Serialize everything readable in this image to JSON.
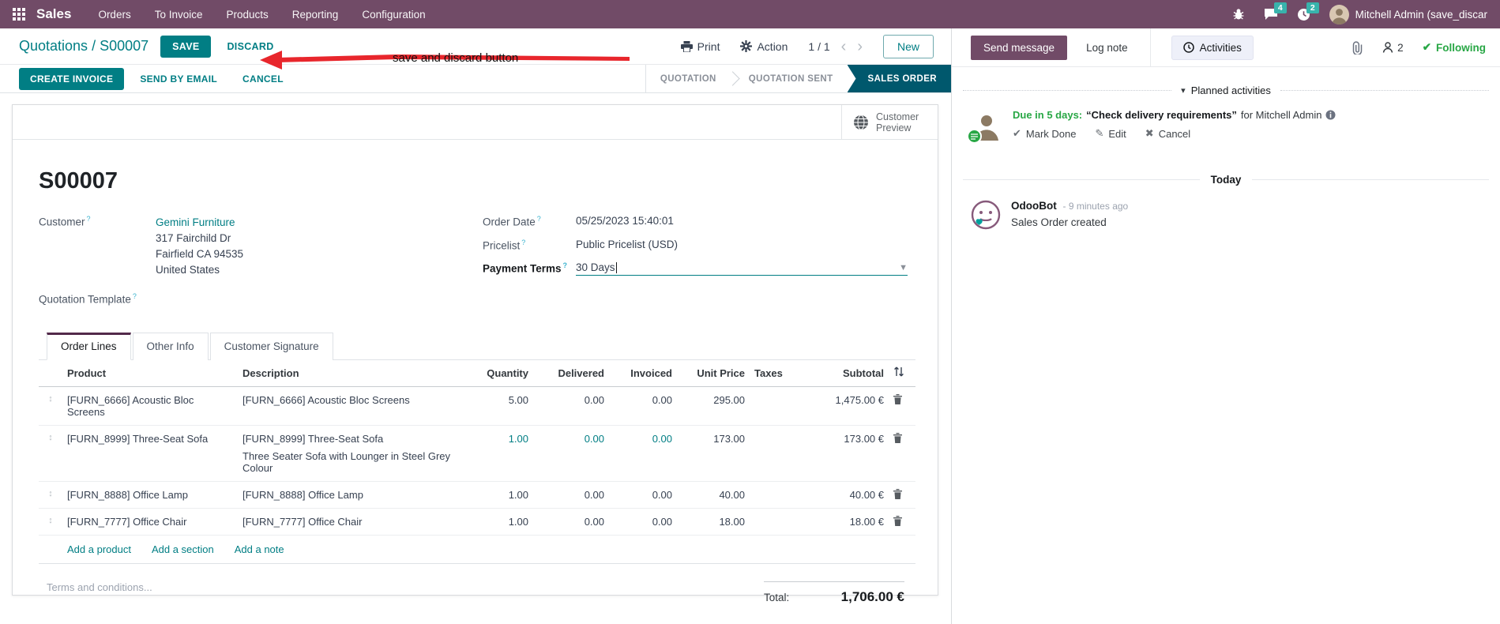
{
  "nav": {
    "app_name": "Sales",
    "menus": [
      "Orders",
      "To Invoice",
      "Products",
      "Reporting",
      "Configuration"
    ],
    "messages_count": "4",
    "activities_count": "2",
    "user_name": "Mitchell Admin (save_discar",
    "accent_color": "#714B67",
    "badge_color": "#38B3AC"
  },
  "control_panel": {
    "breadcrumb_parent": "Quotations",
    "breadcrumb_separator": "/",
    "breadcrumb_current": "S00007",
    "save_label": "SAVE",
    "discard_label": "DISCARD",
    "print_label": "Print",
    "action_label": "Action",
    "pager": "1 / 1",
    "prev": "‹",
    "next": "›",
    "new_label": "New"
  },
  "annotation": {
    "text": "save and discard button",
    "arrow_color": "#e8262c"
  },
  "statusbar": {
    "buttons": [
      {
        "label": "CREATE INVOICE",
        "style": "primary"
      },
      {
        "label": "SEND BY EMAIL",
        "style": "flat"
      },
      {
        "label": "CANCEL",
        "style": "flat"
      }
    ],
    "stages": [
      {
        "label": "QUOTATION",
        "active": false
      },
      {
        "label": "QUOTATION SENT",
        "active": false
      },
      {
        "label": "SALES ORDER",
        "active": true
      }
    ],
    "active_stage_color": "#00586d"
  },
  "form": {
    "preview_label": "Customer Preview",
    "title": "S00007",
    "customer_label": "Customer",
    "customer_name": "Gemini Furniture",
    "address_line1": "317 Fairchild Dr",
    "address_line2": "Fairfield CA 94535",
    "address_line3": "United States",
    "quotation_template_label": "Quotation Template",
    "order_date_label": "Order Date",
    "order_date_value": "05/25/2023 15:40:01",
    "pricelist_label": "Pricelist",
    "pricelist_value": "Public Pricelist (USD)",
    "payment_terms_label": "Payment Terms",
    "payment_terms_value": "30 Days"
  },
  "tabs": [
    {
      "label": "Order Lines",
      "active": true
    },
    {
      "label": "Other Info",
      "active": false
    },
    {
      "label": "Customer Signature",
      "active": false
    }
  ],
  "order_lines": {
    "columns": [
      "Product",
      "Description",
      "Quantity",
      "Delivered",
      "Invoiced",
      "Unit Price",
      "Taxes",
      "Subtotal"
    ],
    "rows": [
      {
        "product": "[FURN_6666] Acoustic Bloc Screens",
        "description": "[FURN_6666] Acoustic Bloc Screens",
        "description2": "",
        "quantity": "5.00",
        "delivered": "0.00",
        "invoiced": "0.00",
        "unit_price": "295.00",
        "taxes": "",
        "subtotal": "1,475.00 €",
        "edited": false
      },
      {
        "product": "[FURN_8999] Three-Seat Sofa",
        "description": "[FURN_8999] Three-Seat Sofa",
        "description2": "Three Seater Sofa with Lounger in Steel Grey Colour",
        "quantity": "1.00",
        "delivered": "0.00",
        "invoiced": "0.00",
        "unit_price": "173.00",
        "taxes": "",
        "subtotal": "173.00 €",
        "edited": true
      },
      {
        "product": "[FURN_8888] Office Lamp",
        "description": "[FURN_8888] Office Lamp",
        "description2": "",
        "quantity": "1.00",
        "delivered": "0.00",
        "invoiced": "0.00",
        "unit_price": "40.00",
        "taxes": "",
        "subtotal": "40.00 €",
        "edited": false
      },
      {
        "product": "[FURN_7777] Office Chair",
        "description": "[FURN_7777] Office Chair",
        "description2": "",
        "quantity": "1.00",
        "delivered": "0.00",
        "invoiced": "0.00",
        "unit_price": "18.00",
        "taxes": "",
        "subtotal": "18.00 €",
        "edited": false
      }
    ],
    "footer_links": [
      "Add a product",
      "Add a section",
      "Add a note"
    ],
    "terms_placeholder": "Terms and conditions...",
    "total_label": "Total:",
    "total_value": "1,706.00 €",
    "edited_color": "#017e84"
  },
  "chatter": {
    "send_message_label": "Send message",
    "log_note_label": "Log note",
    "activities_label": "Activities",
    "followers_count": "2",
    "following_label": "Following",
    "planned_header": "Planned activities",
    "activity": {
      "due": "Due in 5 days:",
      "title": "“Check delivery requirements”",
      "assignee": "for Mitchell Admin",
      "mark_done_label": "Mark Done",
      "edit_label": "Edit",
      "cancel_label": "Cancel"
    },
    "today_label": "Today",
    "message": {
      "author": "OdooBot",
      "time": "- 9 minutes ago",
      "body": "Sales Order created"
    },
    "green_color": "#28a745"
  }
}
